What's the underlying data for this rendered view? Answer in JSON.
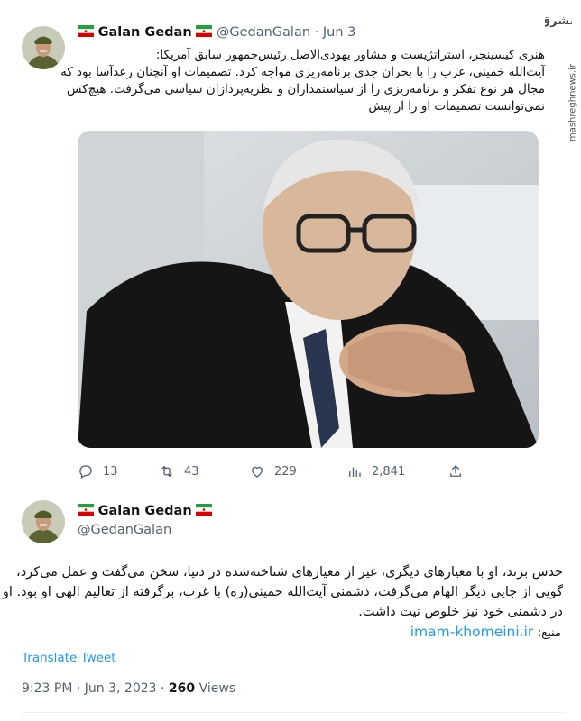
{
  "watermark": {
    "logo_text": "مشرق",
    "side_text": "mashreghnews.ir"
  },
  "tweet1": {
    "display_name": "Galan Gedan",
    "handle": "@GedanGalan",
    "separator": "·",
    "date": "Jun 3",
    "text_lines": [
      "هنری کیسینجر، استراتژیست و مشاور یهودی‌الاصل رئیس‌جمهور سابق آمریکا:",
      "آیت‌الله خمینی، غرب را با بحران جدی برنامه‌ریزی مواجه کرد. تصمیمات او آنچنان رعدآسا بود که",
      "مجال هر نوع تفکر و برنامه‌ریزی را از سیاستمداران و نظریه‌پردازان سیاسی می‌گرفت. هیچ‌کس",
      "نمی‌توانست تصمیمات او را از پیش"
    ],
    "stats": {
      "replies": "13",
      "retweets": "43",
      "likes": "229",
      "views": "2,841"
    },
    "icons": [
      "reply-icon",
      "retweet-icon",
      "like-icon",
      "views-icon",
      "share-icon"
    ]
  },
  "tweet2": {
    "display_name": "Galan Gedan",
    "handle": "@GedanGalan",
    "text_lines": [
      "حدس بزند، او با معیارهای دیگری، غیر از معیارهای شناخته‌شده در دنیا، سخن می‌گفت و عمل می‌کرد،",
      "گویی از جایی دیگر الهام می‌گرفت، دشمنی آیت‌الله خمینی(ره) با غرب، برگرفته از تعالیم الهی او بود. او",
      "در دشمنی خود نیز خلوص نیت داشت."
    ],
    "source_label": "منبع:",
    "source_link": "imam-khomeini.ir",
    "translate_label": "Translate Tweet",
    "time": "9:23 PM",
    "separator": "·",
    "full_date": "Jun 3, 2023",
    "views_count": "260",
    "views_label": "Views"
  },
  "colors": {
    "text": "#0f1419",
    "muted": "#536471",
    "link": "#1d9bf0",
    "divider": "#eff3f4"
  }
}
